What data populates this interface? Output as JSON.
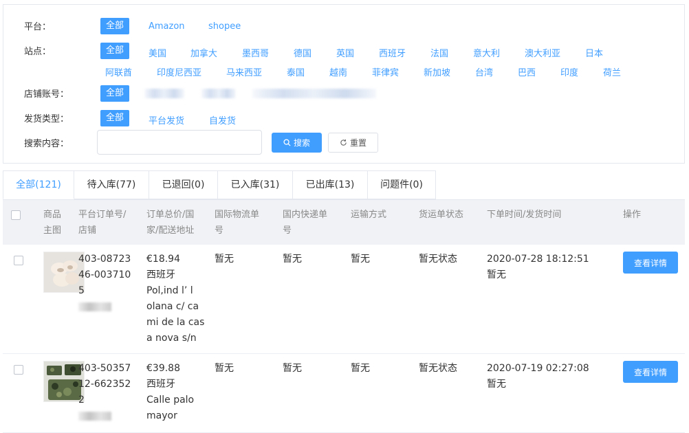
{
  "filters": {
    "platform": {
      "label": "平台：",
      "options": [
        "全部",
        "Amazon",
        "shopee"
      ]
    },
    "site": {
      "label": "站点：",
      "row1": [
        "全部",
        "美国",
        "加拿大",
        "墨西哥",
        "德国",
        "英国",
        "西班牙",
        "法国",
        "意大利",
        "澳大利亚",
        "日本"
      ],
      "row2": [
        "阿联酋",
        "印度尼西亚",
        "马来西亚",
        "泰国",
        "越南",
        "菲律宾",
        "新加坡",
        "台湾",
        "巴西",
        "印度",
        "荷兰"
      ]
    },
    "store": {
      "label": "店铺账号：",
      "options": [
        "全部"
      ]
    },
    "ship_type": {
      "label": "发货类型：",
      "options": [
        "全部",
        "平台发货",
        "自发货"
      ]
    },
    "search": {
      "label": "搜索内容：",
      "placeholder": "",
      "value": "",
      "search_btn": "搜索",
      "reset_btn": "重置"
    }
  },
  "tabs": [
    {
      "label": "全部(121)",
      "active": true
    },
    {
      "label": "待入库(77)",
      "active": false
    },
    {
      "label": "已退回(0)",
      "active": false
    },
    {
      "label": "已入库(31)",
      "active": false
    },
    {
      "label": "已出库(13)",
      "active": false
    },
    {
      "label": "问题件(0)",
      "active": false
    }
  ],
  "table": {
    "headers": [
      "商品主图",
      "平台订单号/店铺",
      "订单总价/国家/配送地址",
      "国际物流单号",
      "国内快递单号",
      "运输方式",
      "货运单状态",
      "下单时间/发货时间",
      "操作"
    ],
    "header_lines": [
      [
        "商品",
        "主图"
      ],
      [
        "平台订单号/",
        "店铺"
      ],
      [
        "订单总价/国",
        "家/配送地址"
      ],
      [
        "国际物流单",
        "号"
      ],
      [
        "国内快递单",
        "号"
      ],
      [
        "运输方式"
      ],
      [
        "货运单状态"
      ],
      [
        "下单时间/发货时间"
      ],
      [
        "操作"
      ]
    ],
    "rows": [
      {
        "order_lines": [
          "403-08723",
          "46-003710",
          "5"
        ],
        "price": "€18.94",
        "country": "西班牙",
        "address_lines": [
          "Pol,ind l’ l",
          "olana c/ ca",
          "mi de la cas",
          "a nova s/n"
        ],
        "intl_tracking": "暂无",
        "dom_tracking": "暂无",
        "shipping": "暂无",
        "status": "暂无状态",
        "order_time": "2020-07-28 18:12:51",
        "ship_time": "暂无",
        "action": "查看详情"
      },
      {
        "order_lines": [
          "403-50357",
          "12-662352",
          "2"
        ],
        "price": "€39.88",
        "country": "西班牙",
        "address_lines": [
          "Calle palo",
          "mayor"
        ],
        "intl_tracking": "暂无",
        "dom_tracking": "暂无",
        "shipping": "暂无",
        "status": "暂无状态",
        "order_time": "2020-07-19 02:27:08",
        "ship_time": "暂无",
        "action": "查看详情"
      }
    ]
  },
  "colors": {
    "accent": "#409eff",
    "header_bg": "#f0f2f5",
    "border": "#e4e7ed"
  },
  "icons": {
    "search": "search-icon",
    "reset": "refresh-icon"
  }
}
